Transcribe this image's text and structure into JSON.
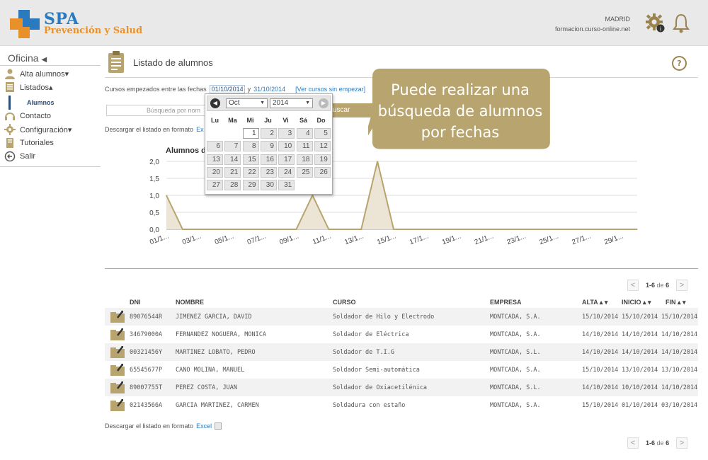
{
  "header": {
    "brand": "SPA",
    "subtitle": "Prevención y Salud",
    "city": "MADRID",
    "domain": "formacion.curso-online.net"
  },
  "sidebar": {
    "title": "Oficina",
    "items": [
      {
        "label": "Alta alumnos▾",
        "icon": "user-icon"
      },
      {
        "label": "Listados▴",
        "icon": "list-icon"
      },
      {
        "label": "Contacto",
        "icon": "headset-icon"
      },
      {
        "label": "Configuración▾",
        "icon": "gear-icon"
      },
      {
        "label": "Tutoriales",
        "icon": "book-icon"
      },
      {
        "label": "Salir",
        "icon": "exit-icon"
      }
    ],
    "sub_item": "Alumnos"
  },
  "page": {
    "title": "Listado de alumnos",
    "help": "?"
  },
  "filter": {
    "label": "Cursos empezados entre las fechas",
    "date_from": "01/10/2014",
    "conj": "y",
    "date_to": "31/10/2014",
    "view_link": "[Ver cursos sin empezar]",
    "search_placeholder": "Búsqueda por nom",
    "search_button": "uscar",
    "download_label": "Descargar el listado en formato",
    "download_partial": "Ex"
  },
  "calendar": {
    "month": "Oct",
    "year": "2014",
    "dows": [
      "Lu",
      "Ma",
      "Mi",
      "Ju",
      "Vi",
      "Sá",
      "Do"
    ],
    "first_weekday_index": 2,
    "days_in_month": 31,
    "selected_day": 1
  },
  "tooltip": {
    "lines": [
      "Puede realizar una",
      "búsqueda de alumnos",
      "por fechas"
    ]
  },
  "chart_data": {
    "type": "area",
    "title": "Alumnos d",
    "x": [
      "01/1...",
      "02",
      "03/1...",
      "04",
      "05/1...",
      "06",
      "07/1...",
      "08",
      "09/1...",
      "10",
      "11/1...",
      "12",
      "13/1...",
      "14",
      "15/1...",
      "16",
      "17/1...",
      "18",
      "19/1...",
      "20",
      "21/1...",
      "22",
      "23/1...",
      "24",
      "25/1...",
      "26",
      "27/1...",
      "28",
      "29/1...",
      "30"
    ],
    "x_tick_labels": [
      "01/1...",
      "03/1...",
      "05/1...",
      "07/1...",
      "09/1...",
      "11/1...",
      "13/1...",
      "15/1...",
      "17/1...",
      "19/1...",
      "21/1...",
      "23/1...",
      "25/1...",
      "27/1...",
      "29/1..."
    ],
    "values": [
      1,
      0,
      0,
      0,
      0,
      0,
      0,
      0,
      0,
      1,
      0,
      0,
      0,
      2,
      0,
      0,
      0,
      0,
      0,
      0,
      0,
      0,
      0,
      0,
      0,
      0,
      0,
      0,
      0,
      0
    ],
    "y_ticks": [
      "0,0",
      "0,5",
      "1,0",
      "1,5",
      "2,0"
    ],
    "ylim": [
      0,
      2
    ],
    "color": "#b8a46f",
    "fill": "#ece4d4",
    "grid": true
  },
  "pager": {
    "range": "1-6",
    "of": "de",
    "total": "6",
    "prev": "<",
    "next": ">"
  },
  "table": {
    "headers": {
      "dni": "DNI",
      "nombre": "NOMBRE",
      "curso": "CURSO",
      "empresa": "EMPRESA",
      "alta": "ALTA ▴ ▾",
      "inicio": "INICIO ▴ ▾",
      "fin": "FIN ▴ ▾"
    },
    "rows": [
      {
        "dni": "89076544R",
        "nombre": "JIMENEZ GARCIA, DAVID",
        "curso": "Soldador de Hilo y Electrodo",
        "empresa": "MONTCADA, S.A.",
        "alta": "15/10/2014",
        "inicio": "15/10/2014",
        "fin": "15/10/2014"
      },
      {
        "dni": "34679000A",
        "nombre": "FERNANDEZ NOGUERA, MONICA",
        "curso": "Soldador de Eléctrica",
        "empresa": "MONTCADA, S.A.",
        "alta": "14/10/2014",
        "inicio": "14/10/2014",
        "fin": "14/10/2014"
      },
      {
        "dni": "00321456Y",
        "nombre": "MARTINEZ LOBATO, PEDRO",
        "curso": "Soldador de T.I.G",
        "empresa": "MONTCADA, S.L.",
        "alta": "14/10/2014",
        "inicio": "14/10/2014",
        "fin": "14/10/2014"
      },
      {
        "dni": "65545677P",
        "nombre": "CANO MOLINA, MANUEL",
        "curso": "Soldador Semi-automática",
        "empresa": "MONTCADA, S.A.",
        "alta": "15/10/2014",
        "inicio": "13/10/2014",
        "fin": "13/10/2014"
      },
      {
        "dni": "89007755T",
        "nombre": "PEREZ COSTA, JUAN",
        "curso": "Soldador de Oxiacetilénica",
        "empresa": "MONTCADA, S.L.",
        "alta": "14/10/2014",
        "inicio": "10/10/2014",
        "fin": "14/10/2014"
      },
      {
        "dni": "02143566A",
        "nombre": "GARCIA MARTINEZ, CARMEN",
        "curso": "Soldadura con estaño",
        "empresa": "MONTCADA, S.A.",
        "alta": "15/10/2014",
        "inicio": "01/10/2014",
        "fin": "03/10/2014"
      }
    ]
  },
  "footer": {
    "download_label": "Descargar el listado en formato",
    "excel": "Excel"
  },
  "colors": {
    "accent": "#b8a46f",
    "link": "#2a7ac0",
    "brand_blue": "#2a7ac0",
    "brand_orange": "#e8912a"
  }
}
